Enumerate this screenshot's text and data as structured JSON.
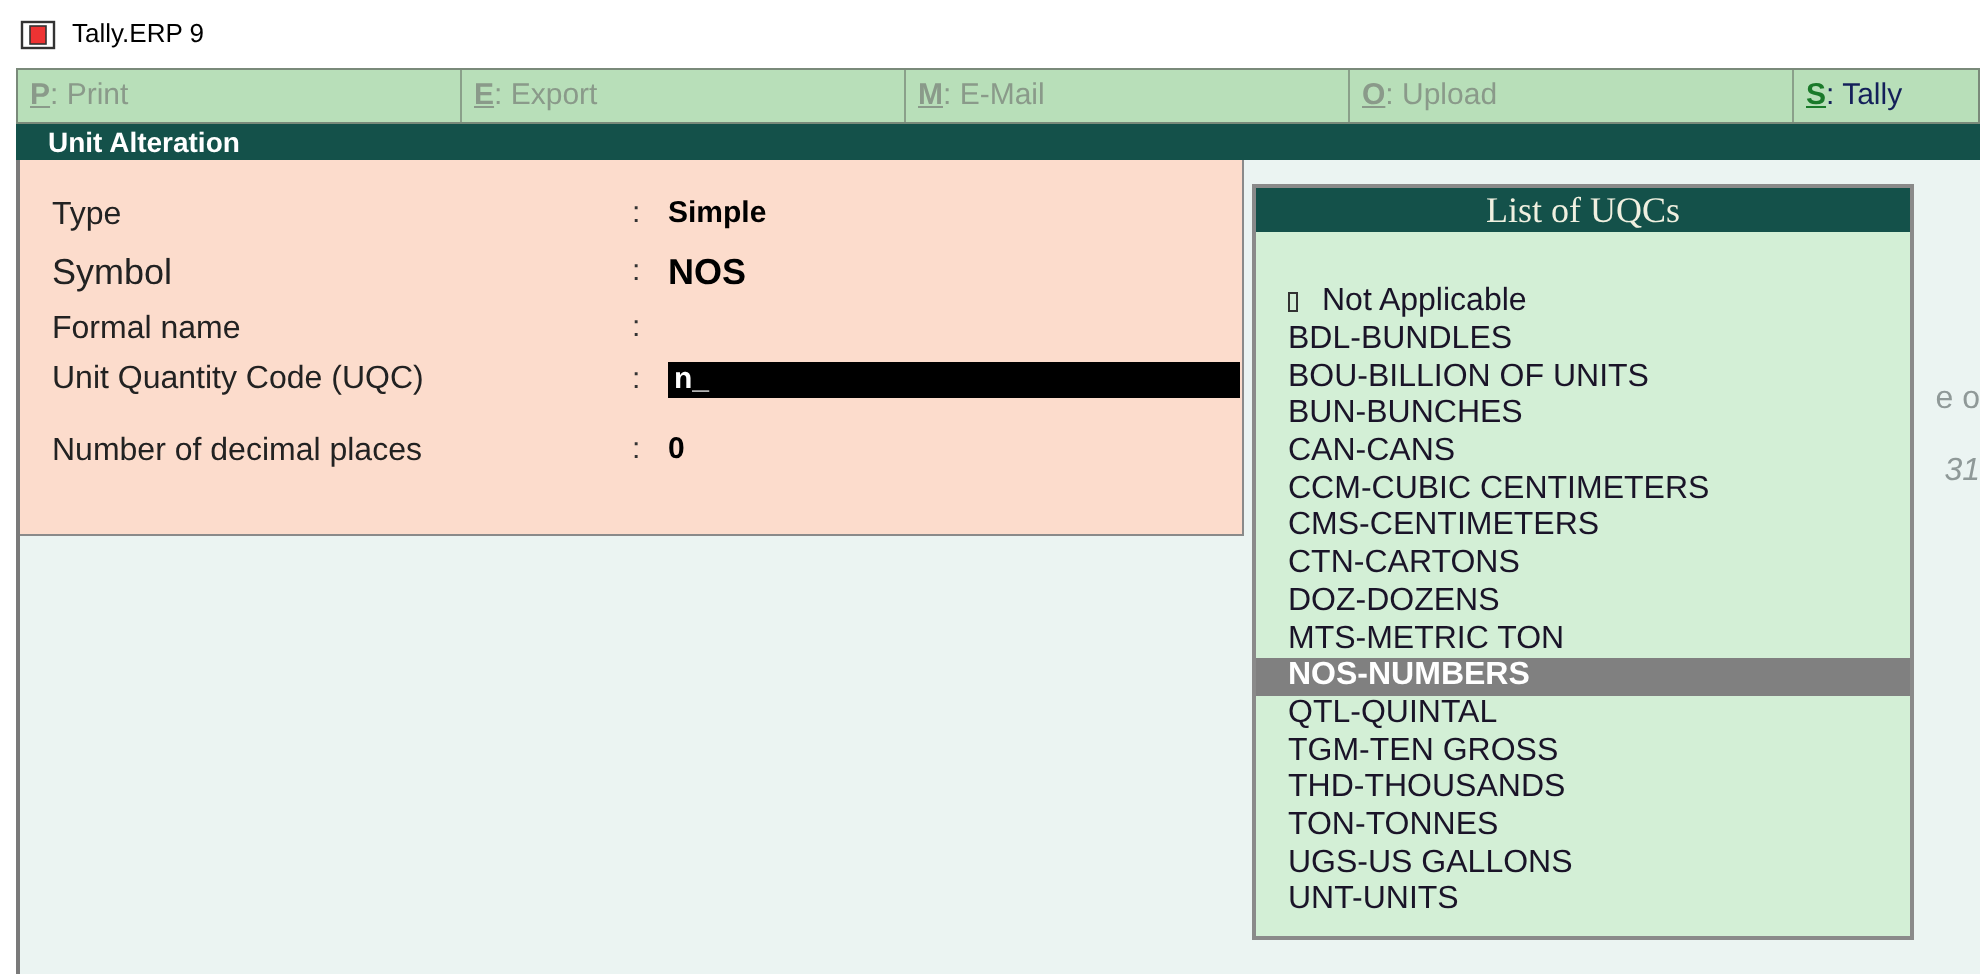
{
  "window": {
    "title": "Tally.ERP 9"
  },
  "toolbar": [
    {
      "key": "P",
      "label": ": Print",
      "disabled": true
    },
    {
      "key": "E",
      "label": ": Export",
      "disabled": true
    },
    {
      "key": "M",
      "label": ": E-Mail",
      "disabled": true
    },
    {
      "key": "O",
      "label": ": Upload",
      "disabled": true
    },
    {
      "key": "S",
      "label": ": Tally",
      "disabled": false
    }
  ],
  "screen_title": "Unit Alteration",
  "form": [
    {
      "kind": "value",
      "label": "Type",
      "separator": ":",
      "value": "Simple",
      "large": false
    },
    {
      "kind": "value",
      "label": "Symbol",
      "separator": ":",
      "value": "NOS",
      "large": true
    },
    {
      "kind": "value",
      "label": "Formal name",
      "separator": ":",
      "large": false
    },
    {
      "kind": "input",
      "label": "Unit Quantity Code (UQC)",
      "separator": ":",
      "value": "n_",
      "large": false
    },
    {
      "kind": "value",
      "label": "Number of decimal places",
      "separator": ":",
      "value": "0",
      "large": false
    }
  ],
  "background_fragments": [
    "e o",
    "31"
  ],
  "list": {
    "title": "List of UQCs",
    "items": [
      {
        "label": "Not Applicable",
        "marker": true,
        "selected": false
      },
      {
        "label": "BDL-BUNDLES",
        "marker": false,
        "selected": false
      },
      {
        "label": "BOU-BILLION OF UNITS",
        "marker": false,
        "selected": false
      },
      {
        "label": "BUN-BUNCHES",
        "marker": false,
        "selected": false
      },
      {
        "label": "CAN-CANS",
        "marker": false,
        "selected": false
      },
      {
        "label": "CCM-CUBIC CENTIMETERS",
        "marker": false,
        "selected": false
      },
      {
        "label": "CMS-CENTIMETERS",
        "marker": false,
        "selected": false
      },
      {
        "label": "CTN-CARTONS",
        "marker": false,
        "selected": false
      },
      {
        "label": "DOZ-DOZENS",
        "marker": false,
        "selected": false
      },
      {
        "label": "MTS-METRIC TON",
        "marker": false,
        "selected": false
      },
      {
        "label": "NOS-NUMBERS",
        "marker": false,
        "selected": true
      },
      {
        "label": "QTL-QUINTAL",
        "marker": false,
        "selected": false
      },
      {
        "label": "TGM-TEN GROSS",
        "marker": false,
        "selected": false
      },
      {
        "label": "THD-THOUSANDS",
        "marker": false,
        "selected": false
      },
      {
        "label": "TON-TONNES",
        "marker": false,
        "selected": false
      },
      {
        "label": "UGS-US GALLONS",
        "marker": false,
        "selected": false
      },
      {
        "label": "UNT-UNITS",
        "marker": false,
        "selected": false
      }
    ]
  }
}
